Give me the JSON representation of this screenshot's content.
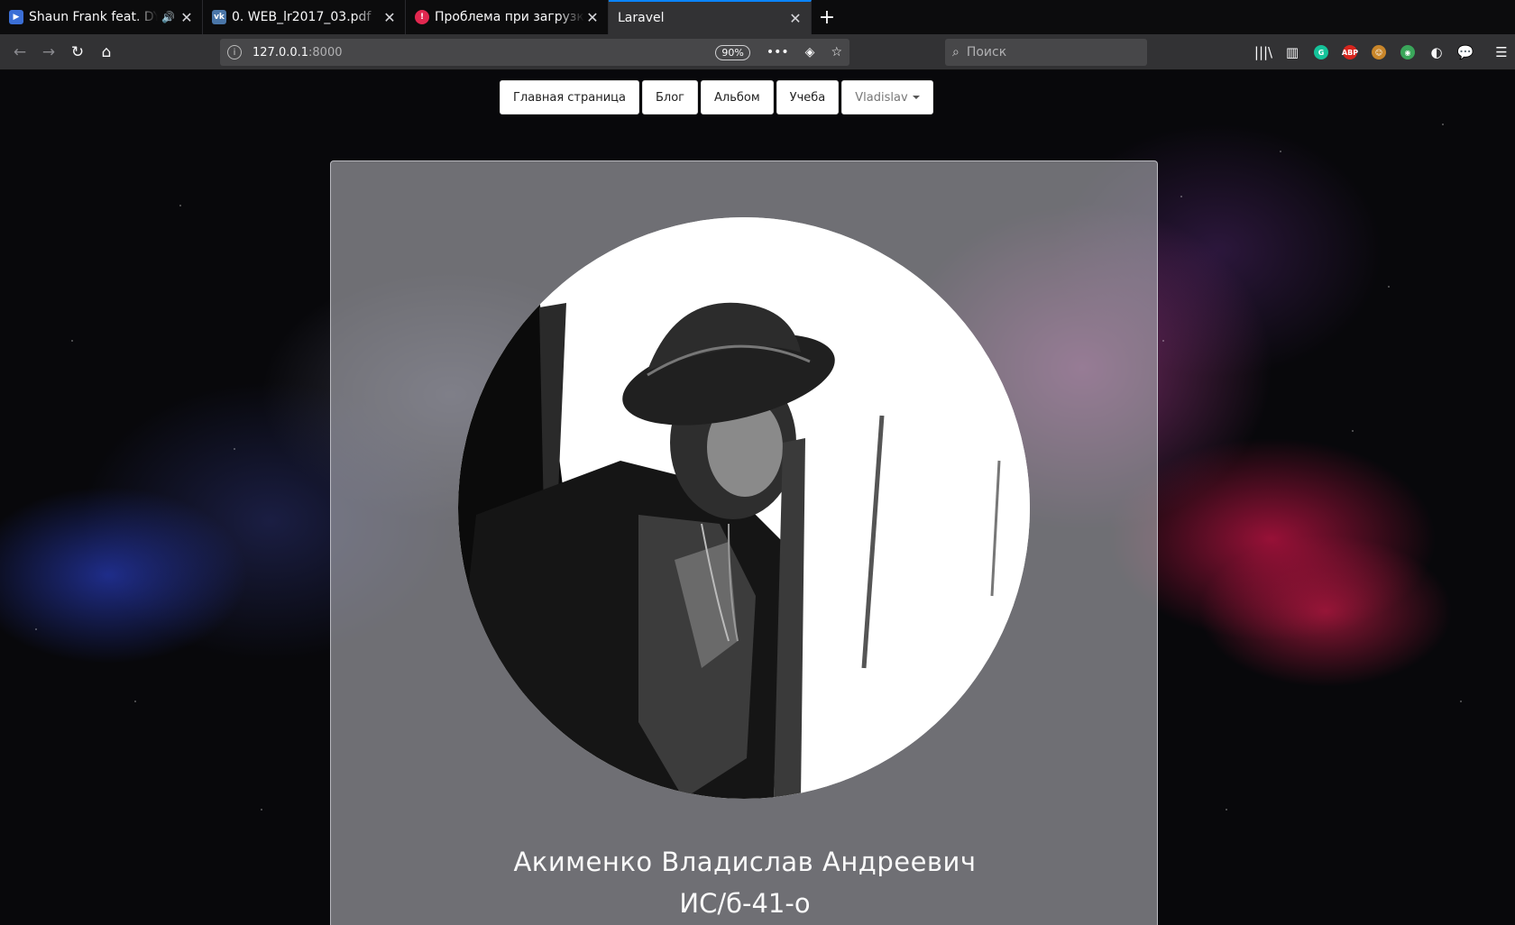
{
  "browser": {
    "tabs": [
      {
        "title": "Shaun Frank feat. DYSON",
        "favicon": "play-icon",
        "audio": true,
        "active": false
      },
      {
        "title": "0. WEB_lr2017_03.pdf",
        "favicon": "vk-icon",
        "audio": false,
        "active": false
      },
      {
        "title": "Проблема при загрузке",
        "favicon": "warning-icon",
        "audio": false,
        "active": false
      },
      {
        "title": "Laravel",
        "favicon": "",
        "audio": false,
        "active": true
      }
    ],
    "url_host": "127.0.0.1",
    "url_port": ":8000",
    "zoom": "90%",
    "search_placeholder": "Поиск"
  },
  "site_nav": {
    "items": [
      "Главная страница",
      "Блог",
      "Альбом",
      "Учеба"
    ],
    "user": "Vladislav"
  },
  "profile": {
    "full_name": "Акименко Владислав Андреевич",
    "group": "ИС/б-41-о"
  },
  "colors": {
    "tab_accent": "#0a84ff",
    "chrome_dark": "#0c0c0d",
    "toolbar": "#323234"
  }
}
